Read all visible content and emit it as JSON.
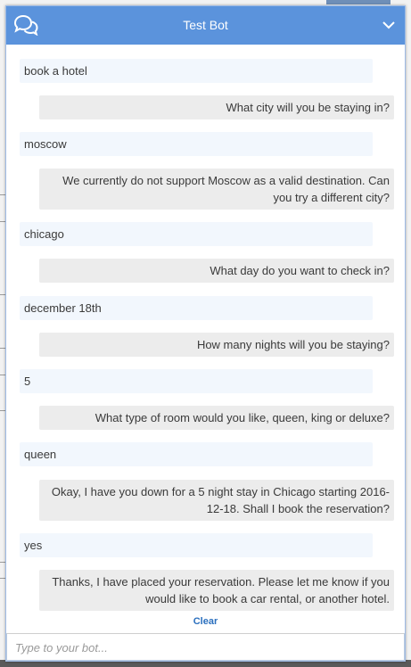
{
  "header": {
    "title": "Test Bot",
    "left_icon": "chat-bubbles-icon",
    "right_icon": "chevron-down-icon",
    "color": "#5b93dc"
  },
  "messages": [
    {
      "role": "user",
      "text": "book a hotel"
    },
    {
      "role": "bot",
      "text": "What city will you be staying in?"
    },
    {
      "role": "user",
      "text": "moscow"
    },
    {
      "role": "bot",
      "text": "We currently do not support Moscow as a valid destination. Can you try a different city?"
    },
    {
      "role": "user",
      "text": "chicago"
    },
    {
      "role": "bot",
      "text": "What day do you want to check in?"
    },
    {
      "role": "user",
      "text": "december 18th"
    },
    {
      "role": "bot",
      "text": "How many nights will you be staying?"
    },
    {
      "role": "user",
      "text": "5"
    },
    {
      "role": "bot",
      "text": "What type of room would you like, queen, king or deluxe?"
    },
    {
      "role": "user",
      "text": "queen"
    },
    {
      "role": "bot",
      "text": "Okay, I have you down for a 5 night stay in Chicago starting 2016-12-18. Shall I book the reservation?"
    },
    {
      "role": "user",
      "text": "yes"
    },
    {
      "role": "bot",
      "text": "Thanks, I have placed your reservation. Please let me know if you would like to book a car rental, or another hotel."
    }
  ],
  "clear_label": "Clear",
  "input": {
    "value": "",
    "placeholder": "Type to your bot..."
  },
  "colors": {
    "user_bubble": "#f2f7fd",
    "bot_bubble": "#ececec",
    "link": "#2a6fbe"
  }
}
